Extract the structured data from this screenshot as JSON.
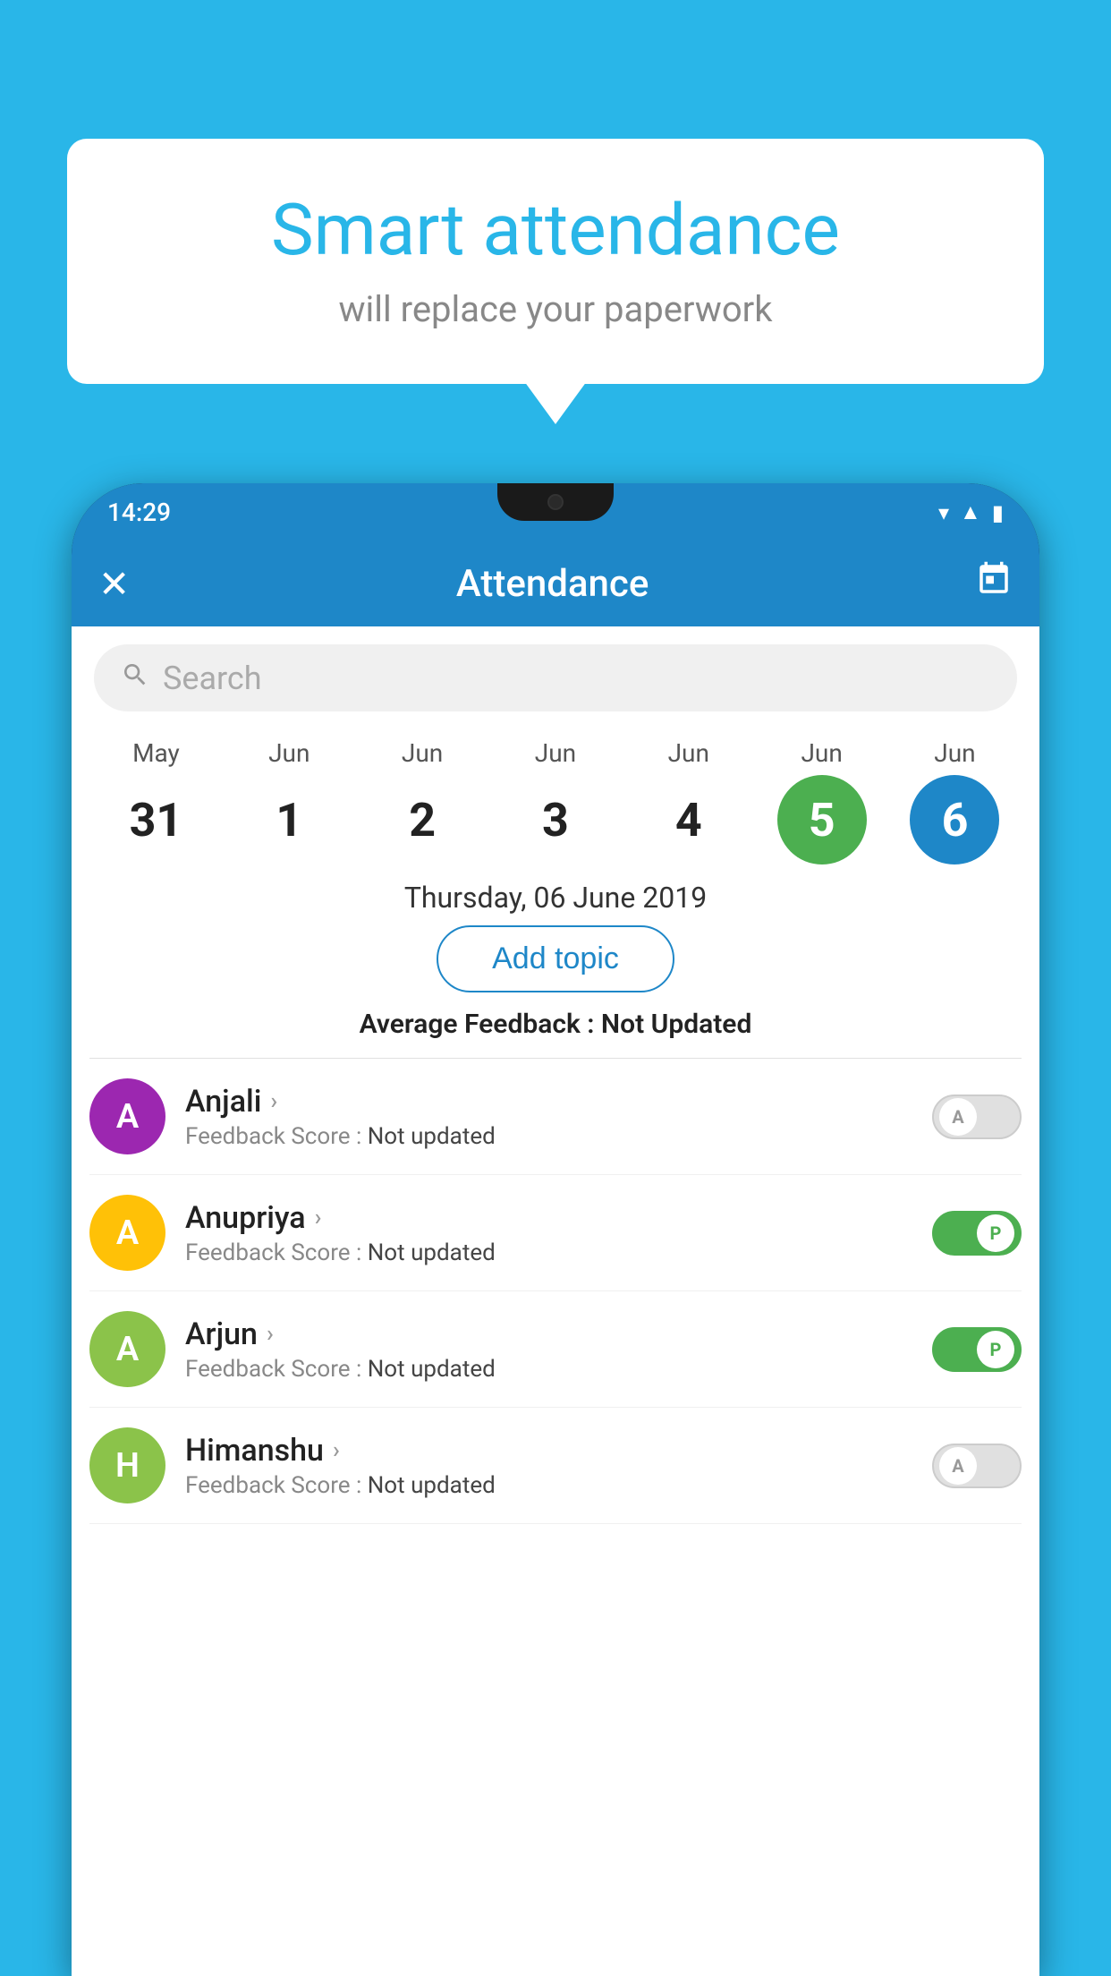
{
  "background_color": "#29B6E8",
  "bubble": {
    "title": "Smart attendance",
    "subtitle": "will replace your paperwork"
  },
  "status_bar": {
    "time": "14:29",
    "icons": [
      "wifi",
      "signal",
      "battery"
    ]
  },
  "app_bar": {
    "title": "Attendance",
    "close_label": "✕",
    "calendar_label": "📅"
  },
  "search": {
    "placeholder": "Search"
  },
  "calendar": {
    "days": [
      {
        "month": "May",
        "date": "31",
        "state": "normal"
      },
      {
        "month": "Jun",
        "date": "1",
        "state": "normal"
      },
      {
        "month": "Jun",
        "date": "2",
        "state": "normal"
      },
      {
        "month": "Jun",
        "date": "3",
        "state": "normal"
      },
      {
        "month": "Jun",
        "date": "4",
        "state": "normal"
      },
      {
        "month": "Jun",
        "date": "5",
        "state": "today"
      },
      {
        "month": "Jun",
        "date": "6",
        "state": "selected"
      }
    ],
    "selected_date_label": "Thursday, 06 June 2019"
  },
  "add_topic_label": "Add topic",
  "avg_feedback": {
    "label": "Average Feedback : ",
    "value": "Not Updated"
  },
  "students": [
    {
      "name": "Anjali",
      "avatar_letter": "A",
      "avatar_color": "#9C27B0",
      "feedback": "Feedback Score : ",
      "feedback_value": "Not updated",
      "toggle": "off",
      "toggle_label": "A"
    },
    {
      "name": "Anupriya",
      "avatar_letter": "A",
      "avatar_color": "#FFC107",
      "feedback": "Feedback Score : ",
      "feedback_value": "Not updated",
      "toggle": "on",
      "toggle_label": "P"
    },
    {
      "name": "Arjun",
      "avatar_letter": "A",
      "avatar_color": "#8BC34A",
      "feedback": "Feedback Score : ",
      "feedback_value": "Not updated",
      "toggle": "on",
      "toggle_label": "P"
    },
    {
      "name": "Himanshu",
      "avatar_letter": "H",
      "avatar_color": "#8BC34A",
      "feedback": "Feedback Score : ",
      "feedback_value": "Not updated",
      "toggle": "off",
      "toggle_label": "A"
    }
  ]
}
